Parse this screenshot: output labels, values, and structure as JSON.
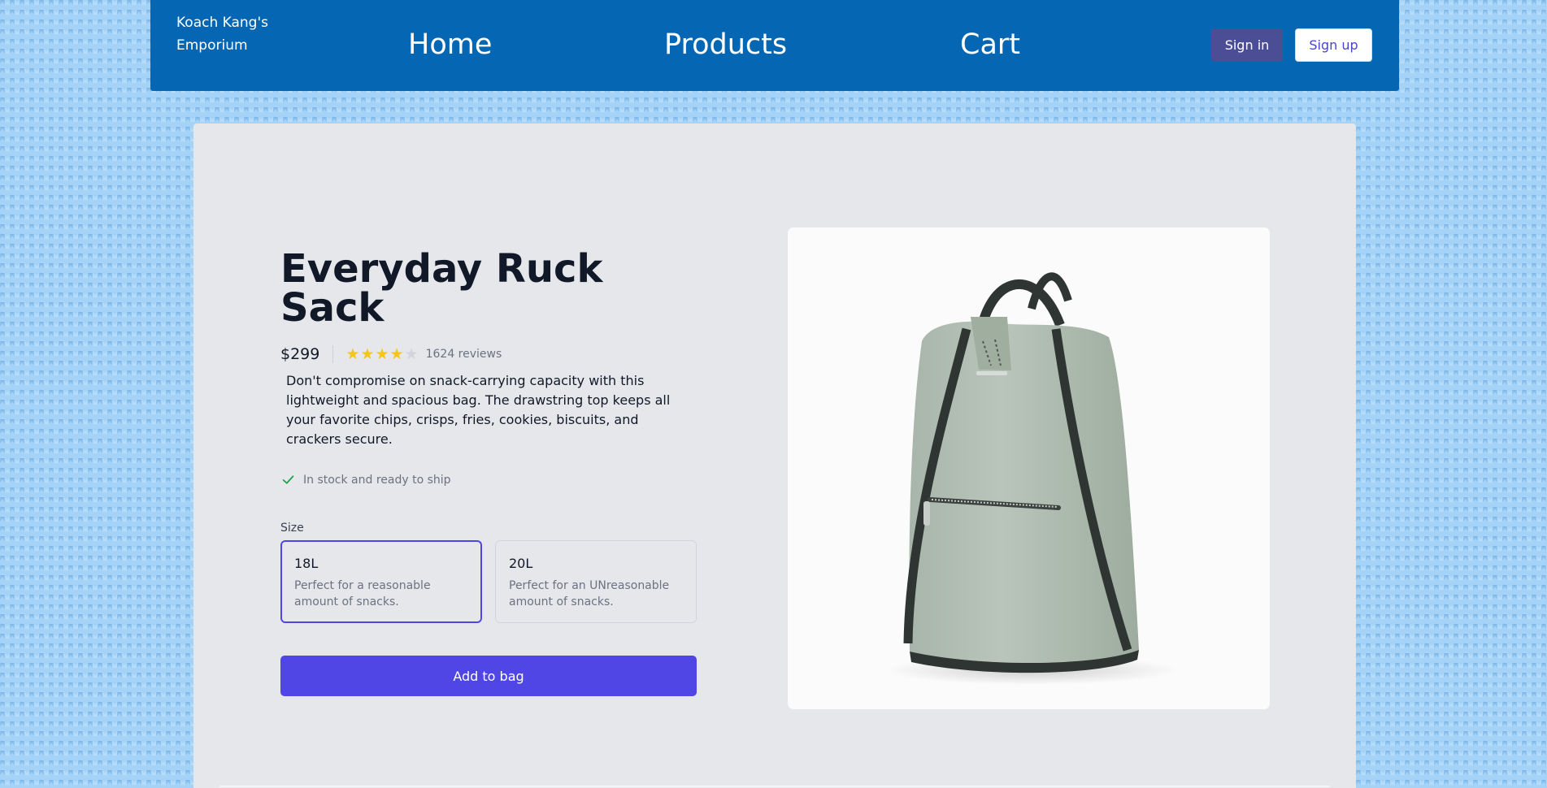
{
  "brand": {
    "name": "Koach Kang's Emporium"
  },
  "nav": {
    "home": "Home",
    "products": "Products",
    "cart": "Cart",
    "sign_in": "Sign in",
    "sign_up": "Sign up"
  },
  "product": {
    "title": "Everyday Ruck Sack",
    "price": "$299",
    "rating": 4,
    "rating_max": 5,
    "reviews": "1624 reviews",
    "description": "Don't compromise on snack-carrying capacity with this lightweight and spacious bag. The drawstring top keeps all your favorite chips, crisps, fries, cookies, biscuits, and crackers secure.",
    "stock": "In stock and ready to ship",
    "size_label": "Size",
    "sizes": [
      {
        "name": "18L",
        "desc": "Perfect for a reasonable amount of snacks.",
        "selected": true
      },
      {
        "name": "20L",
        "desc": "Perfect for an UNreasonable amount of snacks.",
        "selected": false
      }
    ],
    "add_button": "Add to bag",
    "image": "green-drawstring-backpack"
  },
  "colors": {
    "navbar": "#0567b4",
    "accent": "#4f46e5",
    "star": "#f5c518",
    "stock_check": "#16a34a"
  }
}
